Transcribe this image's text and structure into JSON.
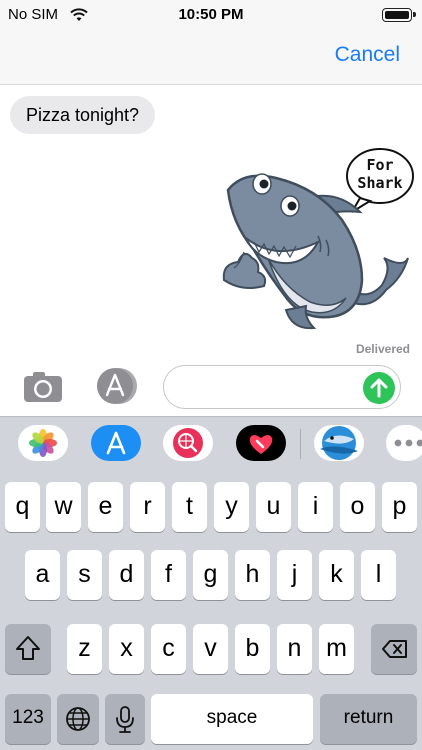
{
  "status_bar": {
    "carrier": "No SIM",
    "time": "10:50 PM"
  },
  "nav": {
    "cancel_label": "Cancel"
  },
  "messages": [
    {
      "direction": "incoming",
      "text": "Pizza tonight?"
    },
    {
      "direction": "outgoing",
      "type": "sticker",
      "sticker_text_line1": "For",
      "sticker_text_line2": "Shark"
    }
  ],
  "delivery_status": "Delivered",
  "composer": {
    "value": "",
    "placeholder": ""
  },
  "app_drawer": {
    "apps": [
      "photos-icon",
      "app-store-icon",
      "web-search-icon",
      "digital-touch-icon",
      "shark-sticker-icon",
      "more-icon"
    ]
  },
  "keyboard": {
    "row1": [
      "q",
      "w",
      "e",
      "r",
      "t",
      "y",
      "u",
      "i",
      "o",
      "p"
    ],
    "row2": [
      "a",
      "s",
      "d",
      "f",
      "g",
      "h",
      "j",
      "k",
      "l"
    ],
    "row3": [
      "z",
      "x",
      "c",
      "v",
      "b",
      "n",
      "m"
    ],
    "numbers_label": "123",
    "space_label": "space",
    "return_label": "return"
  },
  "colors": {
    "accent": "#1a7cf5",
    "send": "#2fc45a",
    "keyboard_bg": "#d1d4db"
  }
}
